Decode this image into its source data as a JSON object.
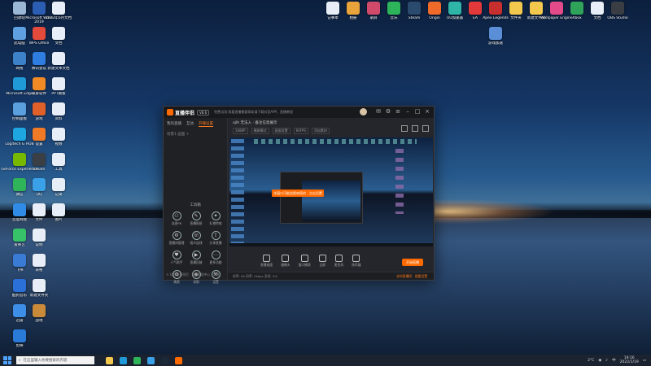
{
  "desktop": {
    "icons": [
      {
        "label": "回收站",
        "color": "#9bb7d6"
      },
      {
        "label": "Microsoft Word 2019",
        "color": "#2b5eb3"
      },
      {
        "label": "2023年6月文档",
        "color": "#e7eef7"
      },
      {
        "label": "此电脑",
        "color": "#5fa0e0"
      },
      {
        "label": "WPS Office",
        "color": "#e24a3b"
      },
      {
        "label": "文档",
        "color": "#e7eef7"
      },
      {
        "label": "网络",
        "color": "#3d82c8"
      },
      {
        "label": "腾讯会议",
        "color": "#2f7de1"
      },
      {
        "label": "新建文本文档",
        "color": "#e7eef7"
      },
      {
        "label": "Microsoft Edge",
        "color": "#1f9ad6"
      },
      {
        "label": "录屏软件",
        "color": "#f08a24"
      },
      {
        "label": "PPT模板",
        "color": "#e7eef7"
      },
      {
        "label": "控制面板",
        "color": "#5aa0de"
      },
      {
        "label": "游戏",
        "color": "#e0602a"
      },
      {
        "label": "资料",
        "color": "#e7eef7"
      },
      {
        "label": "Logitech G HUB",
        "color": "#1da6e0"
      },
      {
        "label": "设置",
        "color": "#f07a26"
      },
      {
        "label": "视频",
        "color": "#e7eef7"
      },
      {
        "label": "GeForce Experience",
        "color": "#76b900"
      },
      {
        "label": "Steam",
        "color": "#3a3f46"
      },
      {
        "label": "工具",
        "color": "#e7eef7"
      },
      {
        "label": "微信",
        "color": "#2fb45a"
      },
      {
        "label": "QQ",
        "color": "#3aa0e8"
      },
      {
        "label": "记录",
        "color": "#e7eef7"
      },
      {
        "label": "百度网盘",
        "color": "#2f8be6"
      },
      {
        "label": "文件",
        "color": "#e7eef7"
      },
      {
        "label": "图片",
        "color": "#e7eef7"
      },
      {
        "label": "爱奇艺",
        "color": "#37c26a"
      },
      {
        "label": "说明",
        "color": "#e7eef7"
      },
      {
        "label": "飞书",
        "color": "#3a7bd5"
      },
      {
        "label": "表格",
        "color": "#e7eef7"
      },
      {
        "label": "酷狗音乐",
        "color": "#2b6fd9"
      },
      {
        "label": "新建文件夹",
        "color": "#e7eef7"
      },
      {
        "label": "迅雷",
        "color": "#3c8ee6"
      },
      {
        "label": "战地",
        "color": "#c98b3a"
      },
      {
        "label": "剪映",
        "color": "#2a7bd8"
      },
      {
        "label": "记事本",
        "color": "#e7eef7"
      },
      {
        "label": "相册",
        "color": "#e8a33a"
      },
      {
        "label": "录屏",
        "color": "#d24a6a"
      },
      {
        "label": "音乐",
        "color": "#2db35a"
      },
      {
        "label": "Steam",
        "color": "#2a4a6e"
      },
      {
        "label": "Origin",
        "color": "#f06a2a"
      },
      {
        "label": "UU加速器",
        "color": "#2fb5a8"
      },
      {
        "label": "EA",
        "color": "#e23a3a"
      },
      {
        "label": "Apex Legends",
        "color": "#c72f2f"
      },
      {
        "label": "文件夹",
        "color": "#f2c94c"
      },
      {
        "label": "新建文件夹",
        "color": "#f2c94c"
      },
      {
        "label": "Wallpaper Engine",
        "color": "#e24a8a"
      },
      {
        "label": "Xbox",
        "color": "#2fa35a"
      },
      {
        "label": "文档",
        "color": "#e7eef7"
      },
      {
        "label": "OBS Studio",
        "color": "#3a3d44"
      },
      {
        "label": "游戏加速",
        "color": "#5a8fd8"
      }
    ]
  },
  "app": {
    "name": "直播伴侣",
    "version": "V8.6",
    "title_text": "免费试用·观看直播需要帮助请下载抖音APP，直播教程",
    "left_tabs": [
      "我的直播",
      "互动",
      "开播设置"
    ],
    "left_subrow": "场景1  画面 +",
    "tools_title": "工具箱",
    "tools": [
      {
        "label": "连麦PK",
        "icon": "⚇"
      },
      {
        "label": "直播贴纸",
        "icon": "✎"
      },
      {
        "label": "礼物特效",
        "icon": "✦"
      },
      {
        "label": "直播间管理",
        "icon": "⚙"
      },
      {
        "label": "观众连线",
        "icon": "☏"
      },
      {
        "label": "分享直播",
        "icon": "⇪"
      },
      {
        "label": "人气助手",
        "icon": "♥"
      },
      {
        "label": "直播回放",
        "icon": "▶"
      },
      {
        "label": "更多功能",
        "icon": "⋯"
      },
      {
        "label": "美颜",
        "icon": "✿"
      },
      {
        "label": "录制",
        "icon": "◉"
      },
      {
        "label": "设置",
        "icon": "⚒"
      }
    ],
    "left_footer": "© 抖音直播伴侣 · 直播帮助中心 · 反馈",
    "main_title": "ojlh 无法入 · 备注信息展示",
    "main_row": [
      "1080P",
      "横屏模式",
      "画面设置",
      "60FPS",
      "添加素材"
    ],
    "preview_toast": "本窗口可能会影响您的 · 点击设置",
    "controls": [
      "直播画面",
      "摄像头",
      "窗口捕获",
      "全屏",
      "麦克风",
      "扬声器"
    ],
    "start_button": "开始直播",
    "footer_hint": "实时直播间 · 观看设置",
    "footer_stats": "帧率: 60  码率: 0kbps  丢帧: 0%"
  },
  "taskbar": {
    "search_placeholder": "在这里输入你要搜索的内容",
    "apps": [
      {
        "name": "file-explorer",
        "color": "#f2c94c"
      },
      {
        "name": "edge",
        "color": "#1f9ad6"
      },
      {
        "name": "wechat",
        "color": "#2fb45a"
      },
      {
        "name": "qq",
        "color": "#3aa0e8"
      },
      {
        "name": "steam",
        "color": "#1b2838"
      },
      {
        "name": "live-companion",
        "color": "#ff6a00"
      }
    ],
    "temperature": "2°C",
    "lang": "中",
    "time": "19:16",
    "date": "2022/1/19"
  }
}
